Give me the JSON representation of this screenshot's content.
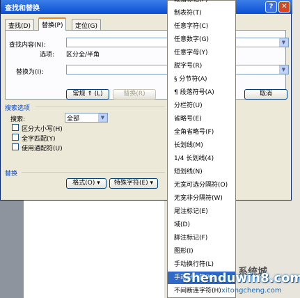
{
  "dialog": {
    "title": "查找和替换",
    "help_glyph": "?",
    "close_glyph": "✕",
    "tabs": [
      {
        "label": "查找(D)"
      },
      {
        "label": "替换(P)"
      },
      {
        "label": "定位(G)"
      }
    ],
    "find": {
      "label": "查找内容(N):",
      "value": "",
      "options_label": "选项:",
      "options_value": "区分全/半角"
    },
    "replace": {
      "label": "替换为(I):",
      "value": ""
    },
    "buttons": {
      "normal": "常规 ⇑ (L)",
      "replace": "替换(R)",
      "cancel": "取消"
    },
    "search_options": {
      "title": "搜索选项",
      "search_label": "搜索:",
      "search_value": "全部",
      "checks": [
        {
          "label": "区分大小写(H)",
          "checked": false
        },
        {
          "label": "全字匹配(Y)",
          "checked": false
        },
        {
          "label": "使用通配符(U)",
          "checked": false
        }
      ]
    },
    "replace_section": {
      "title": "替换",
      "format_button": "格式(O) ▾",
      "special_button": "特殊字符(E) ▾"
    }
  },
  "menu": {
    "items": [
      {
        "label": "段落标记(P)"
      },
      {
        "label": "制表符(T)"
      },
      {
        "label": "任意字符(C)"
      },
      {
        "label": "任意数字(G)"
      },
      {
        "label": "任意字母(Y)"
      },
      {
        "label": "脱字号(R)"
      },
      {
        "label": "§ 分节符(A)"
      },
      {
        "label": "¶ 段落符号(A)"
      },
      {
        "label": "分栏符(U)"
      },
      {
        "label": "省略号(E)"
      },
      {
        "label": "全角省略号(F)"
      },
      {
        "label": "长划线(M)"
      },
      {
        "label": "1/4 长划线(4)"
      },
      {
        "label": "短划线(N)"
      },
      {
        "label": "无宽可选分隔符(O)"
      },
      {
        "label": "无宽非分隔符(W)"
      },
      {
        "label": "尾注标记(E)"
      },
      {
        "label": "域(D)"
      },
      {
        "label": "脚注标记(F)"
      },
      {
        "label": "图形(I)"
      },
      {
        "label": "手动换行符(L)"
      },
      {
        "label": "手动分页符(K)"
      },
      {
        "label": "不间断连字符(H)"
      }
    ],
    "highlighted_index": 21
  },
  "watermark": {
    "text": "Shenduwin8.com",
    "sub": "xitongcheng.com",
    "logo": "系统城"
  }
}
